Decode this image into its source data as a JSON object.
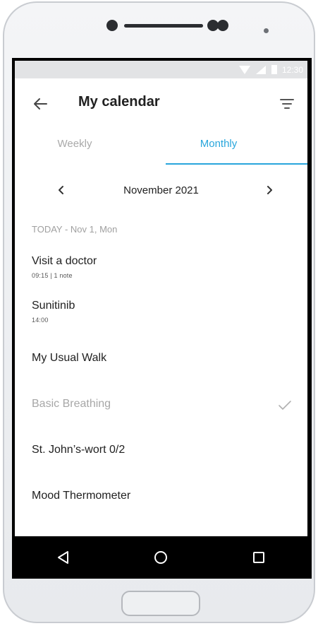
{
  "status_bar": {
    "time": "12:30"
  },
  "app_bar": {
    "title": "My calendar"
  },
  "tabs": [
    {
      "label": "Weekly",
      "selected": false
    },
    {
      "label": "Monthly",
      "selected": true
    }
  ],
  "month_nav": {
    "label": "November 2021"
  },
  "day": {
    "header": "TODAY - Nov 1, Mon",
    "items": [
      {
        "name": "Visit a doctor",
        "meta": "09:15   |   1 note",
        "done": false
      },
      {
        "name": "Sunitinib",
        "meta": "14:00",
        "done": false
      },
      {
        "name": "My Usual Walk",
        "meta": "",
        "done": false
      },
      {
        "name": "Basic Breathing",
        "meta": "",
        "done": true
      },
      {
        "name": "St. John’s-wort 0/2",
        "meta": "",
        "done": false
      },
      {
        "name": "Mood Thermometer",
        "meta": "",
        "done": false
      }
    ]
  },
  "colors": {
    "accent": "#29a6dc",
    "inactive_tab": "#a9a9a9",
    "done_text": "#a7a7a7"
  },
  "icons": {
    "back": "arrow-left-icon",
    "filter": "filter-icon",
    "prev": "chevron-left-icon",
    "next": "chevron-right-icon",
    "check": "check-icon",
    "nav_back": "triangle-back-icon",
    "nav_home": "circle-home-icon",
    "nav_recents": "square-recents-icon"
  }
}
